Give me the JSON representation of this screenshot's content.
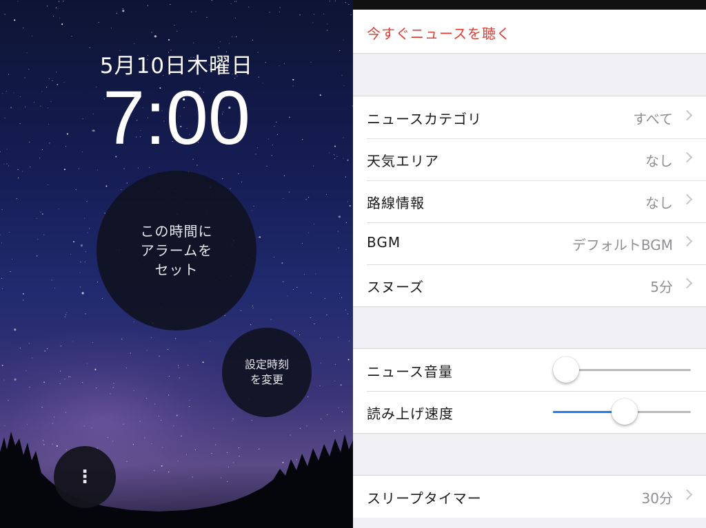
{
  "alarm": {
    "date": "5月10日木曜日",
    "time": "7:00",
    "set_button": [
      "この時間に",
      "アラームを",
      "セット"
    ],
    "change_button": [
      "設定時刻",
      "を変更"
    ],
    "more_button": "⋮"
  },
  "settings": {
    "listen_now": "今すぐニュースを聴く",
    "accent_color": "#e33b2f",
    "group1": [
      {
        "label": "ニュースカテゴリ",
        "value": "すべて"
      },
      {
        "label": "天気エリア",
        "value": "なし"
      },
      {
        "label": "路線情報",
        "value": "なし"
      },
      {
        "label": "BGM",
        "value": "デフォルトBGM"
      },
      {
        "label": "スヌーズ",
        "value": "5分"
      }
    ],
    "group2": [
      {
        "label": "ニュース音量",
        "level": 0.0
      },
      {
        "label": "読み上げ速度",
        "level": 0.52
      }
    ],
    "group3": [
      {
        "label": "スリープタイマー",
        "value": "30分"
      }
    ],
    "slider_fill_color": "#1a7cf0"
  }
}
